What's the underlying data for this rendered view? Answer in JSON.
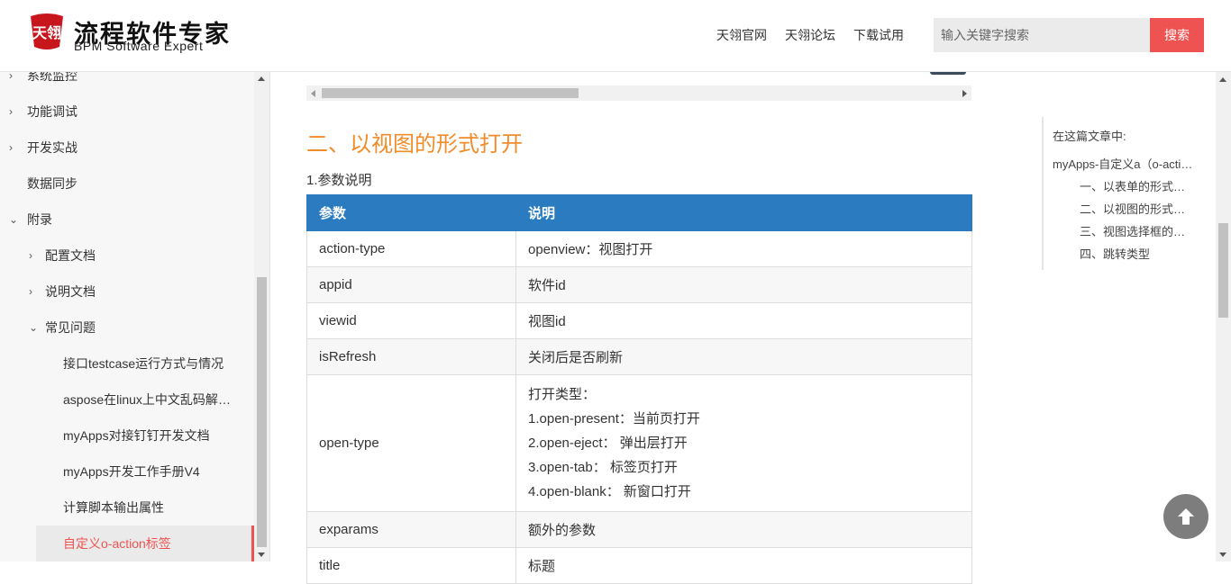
{
  "header": {
    "logo_mark": "天翎",
    "logo_title": "流程软件专家",
    "logo_subtitle": "BPM Software Expert",
    "nav": [
      "天翎官网",
      "天翎论坛",
      "下载试用"
    ],
    "search_placeholder": "输入关键字搜索",
    "search_button": "搜索"
  },
  "sidebar": {
    "items": [
      {
        "label": "系统监控",
        "level": 0,
        "chevron": "right"
      },
      {
        "label": "功能调试",
        "level": 0,
        "chevron": "right"
      },
      {
        "label": "开发实战",
        "level": 0,
        "chevron": "right"
      },
      {
        "label": "数据同步",
        "level": 0,
        "chevron": ""
      },
      {
        "label": "附录",
        "level": 0,
        "chevron": "down"
      },
      {
        "label": "配置文档",
        "level": 1,
        "chevron": "right"
      },
      {
        "label": "说明文档",
        "level": 1,
        "chevron": "right"
      },
      {
        "label": "常见问题",
        "level": 1,
        "chevron": "down"
      },
      {
        "label": "接口testcase运行方式与情况",
        "level": 2,
        "chevron": ""
      },
      {
        "label": "aspose在linux上中文乱码解决方案",
        "level": 2,
        "chevron": ""
      },
      {
        "label": "myApps对接钉钉开发文档",
        "level": 2,
        "chevron": ""
      },
      {
        "label": "myApps开发工作手册V4",
        "level": 2,
        "chevron": ""
      },
      {
        "label": "计算脚本输出属性",
        "level": 2,
        "chevron": ""
      },
      {
        "label": "自定义o-action标签",
        "level": 2,
        "chevron": "",
        "active": true
      }
    ]
  },
  "main": {
    "section_title": "二、以视图的形式打开",
    "sub_heading": "1.参数说明",
    "table": {
      "headers": [
        "参数",
        "说明"
      ],
      "rows": [
        {
          "param": "action-type",
          "desc": [
            "openview：视图打开"
          ]
        },
        {
          "param": "appid",
          "desc": [
            "软件id"
          ]
        },
        {
          "param": "viewid",
          "desc": [
            "视图id"
          ]
        },
        {
          "param": "isRefresh",
          "desc": [
            "关闭后是否刷新"
          ]
        },
        {
          "param": "open-type",
          "desc": [
            "打开类型：",
            "1.open-present：当前页打开",
            "2.open-eject： 弹出层打开",
            "3.open-tab： 标签页打开",
            "4.open-blank： 新窗口打开"
          ]
        },
        {
          "param": "exparams",
          "desc": [
            "额外的参数"
          ]
        },
        {
          "param": "title",
          "desc": [
            "标题"
          ]
        }
      ]
    }
  },
  "toc": {
    "heading": "在这篇文章中:",
    "items": [
      {
        "label": "myApps-自定义a（o-action）标签",
        "level": 0
      },
      {
        "label": "一、以表单的形式打开",
        "level": 1
      },
      {
        "label": "二、以视图的形式打开",
        "level": 1
      },
      {
        "label": "三、视图选择框的形式打开",
        "level": 1
      },
      {
        "label": "四、跳转类型",
        "level": 1
      }
    ]
  },
  "colors": {
    "accent_red": "#ef5351",
    "heading_orange": "#f08c2a",
    "table_header_blue": "#2b7bc0"
  },
  "icons": {
    "to_top": "arrow-up-icon",
    "chevron_right": "chevron-right-icon",
    "chevron_down": "chevron-down-icon"
  }
}
